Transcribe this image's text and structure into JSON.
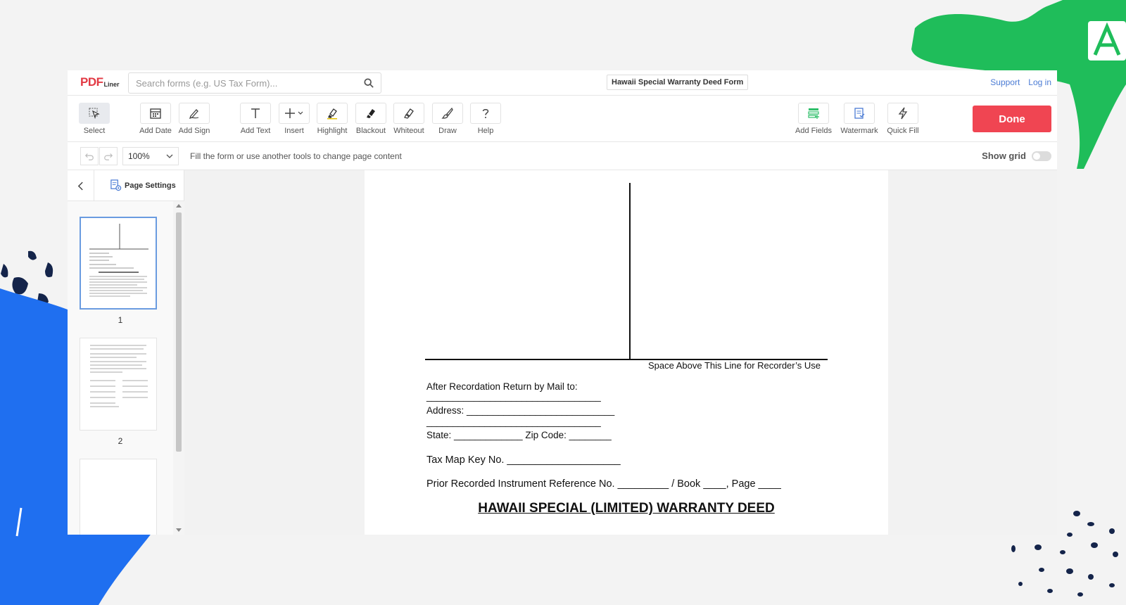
{
  "header": {
    "logo_pdf": "PDF",
    "logo_liner": "Liner",
    "search_placeholder": "Search forms (e.g. US Tax Form)...",
    "doc_title": "Hawaii Special Warranty Deed Form",
    "support_label": "Support",
    "login_label": "Log in"
  },
  "toolbar": {
    "select": "Select",
    "add_date": "Add Date",
    "add_sign": "Add Sign",
    "add_text": "Add Text",
    "insert": "Insert",
    "highlight": "Highlight",
    "blackout": "Blackout",
    "whiteout": "Whiteout",
    "draw": "Draw",
    "help": "Help",
    "add_fields": "Add Fields",
    "watermark": "Watermark",
    "quick_fill": "Quick Fill",
    "done": "Done"
  },
  "subbar": {
    "zoom": "100%",
    "hint": "Fill the form or use another tools to change page content",
    "show_grid": "Show grid"
  },
  "sidebar": {
    "page_settings": "Page Settings",
    "pages": [
      "1",
      "2"
    ]
  },
  "document": {
    "recorder_line": "Space Above This Line for Recorder’s Use",
    "return_mail": "After Recordation Return by Mail to:",
    "blank_line": "_________________________________",
    "address": "Address:  ____________________________",
    "state_zip": "State: _____________ Zip Code: ________",
    "tax_map": "Tax Map Key No.  ____________________",
    "prior_ref": "Prior Recorded Instrument Reference No. _________ / Book ____, Page ____",
    "deed_title": "HAWAII SPECIAL (LIMITED) WARRANTY DEED"
  },
  "colors": {
    "brand_red": "#e23a44",
    "done_button": "#f04552",
    "link_blue": "#4a7bd4",
    "deco_green": "#1fbd5a",
    "deco_blue": "#1f6ff0"
  }
}
